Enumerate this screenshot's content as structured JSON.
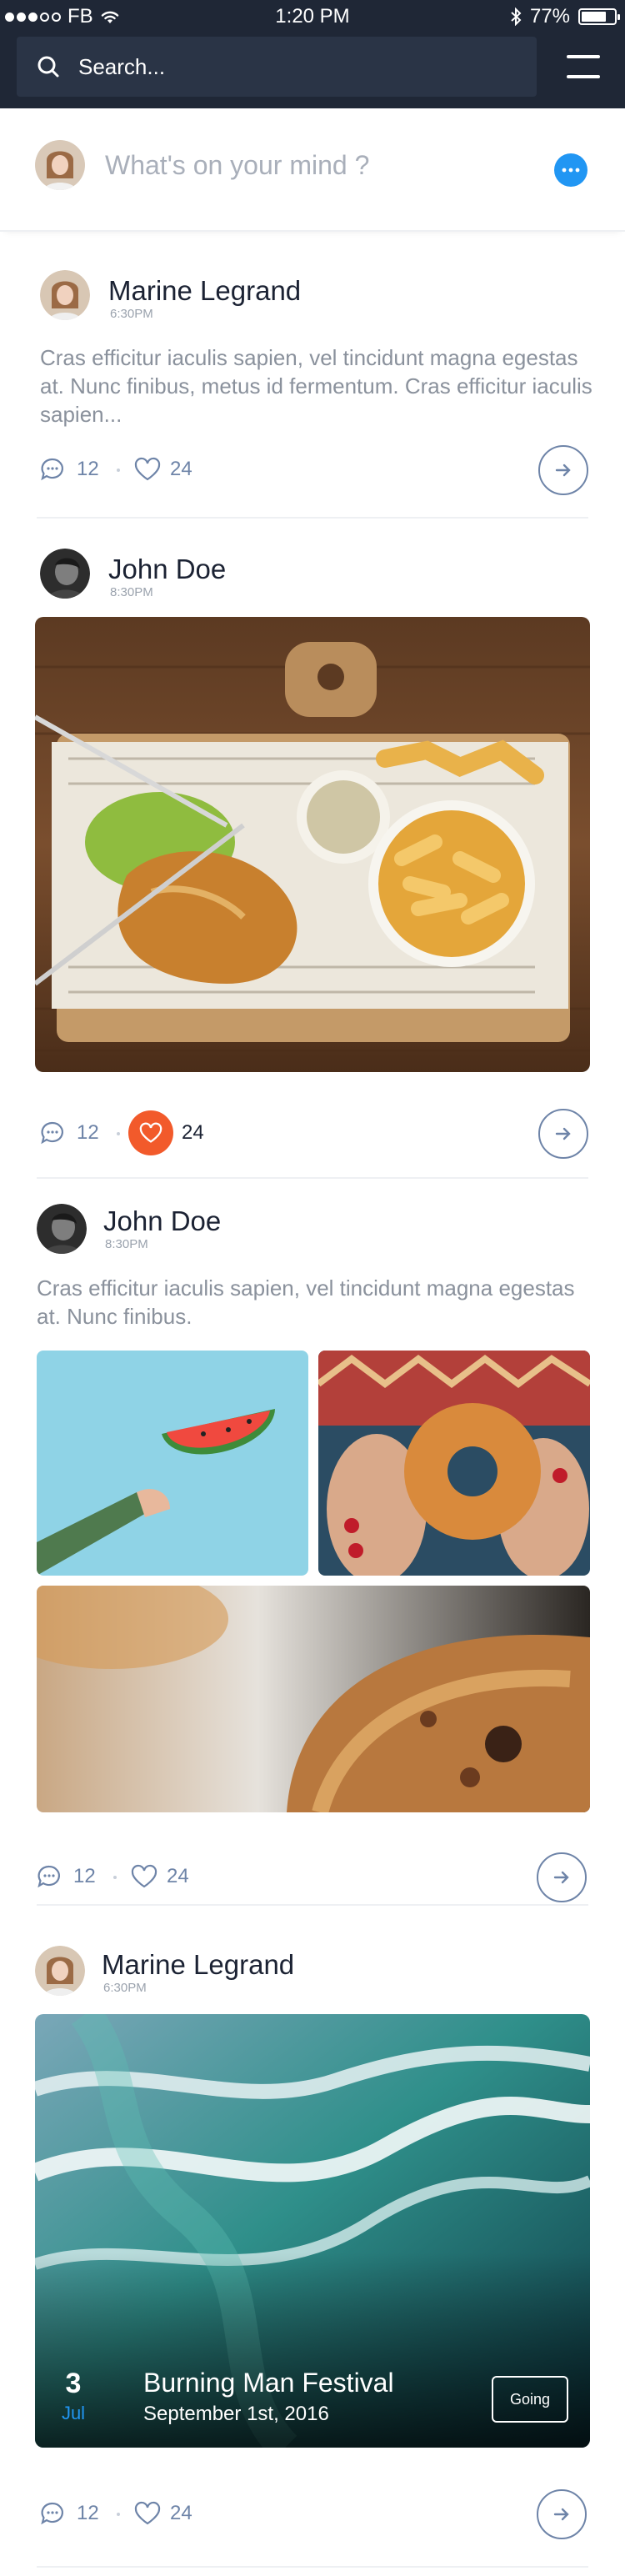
{
  "status_bar": {
    "carrier": "FB",
    "time": "1:20 PM",
    "battery": "77%",
    "battery_level": 0.77
  },
  "header": {
    "search_placeholder": "Search..."
  },
  "composer": {
    "placeholder": "What's on your mind ?"
  },
  "posts": [
    {
      "author": "Marine Legrand",
      "time": "6:30PM",
      "text": "Cras efficitur iaculis sapien, vel tincidunt magna egestas at. Nunc finibus, metus id fermentum. Cras efficitur iaculis sapien...",
      "comments": "12",
      "likes": "24",
      "liked": false
    },
    {
      "author": "John Doe",
      "time": "8:30PM",
      "comments": "12",
      "likes": "24",
      "liked": true,
      "photo": "fish-and-chips-photo"
    },
    {
      "author": "John Doe",
      "time": "8:30PM",
      "text": "Cras efficitur iaculis sapien, vel tincidunt magna egestas at. Nunc finibus.",
      "comments": "12",
      "likes": "24",
      "liked": false,
      "photos": [
        "watermelon-photo",
        "donut-photo",
        "pastry-photo"
      ]
    },
    {
      "author": "Marine Legrand",
      "time": "6:30PM",
      "comments": "12",
      "likes": "24",
      "liked": false,
      "event": {
        "day": "3",
        "month": "Jul",
        "title": "Burning Man Festival",
        "date": "September 1st, 2016",
        "cta": "Going"
      }
    }
  ],
  "colors": {
    "header_bg": "#1f2736",
    "accent_blue": "#2196f3",
    "like_orange": "#f25a2b",
    "icon_blue": "#6e84a8"
  }
}
